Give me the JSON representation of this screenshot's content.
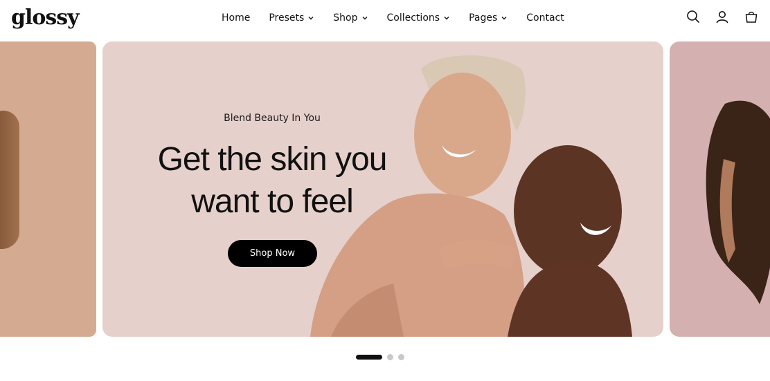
{
  "brand": {
    "logo_text": "glossy"
  },
  "nav": {
    "items": [
      {
        "label": "Home",
        "has_dropdown": false
      },
      {
        "label": "Presets",
        "has_dropdown": true
      },
      {
        "label": "Shop",
        "has_dropdown": true
      },
      {
        "label": "Collections",
        "has_dropdown": true
      },
      {
        "label": "Pages",
        "has_dropdown": true
      },
      {
        "label": "Contact",
        "has_dropdown": false
      }
    ]
  },
  "header_icons": [
    "search-icon",
    "account-icon",
    "cart-icon"
  ],
  "hero": {
    "subtitle": "Blend Beauty In You",
    "headline_line1": "Get the skin you",
    "headline_line2": "want to feel",
    "cta_label": "Shop Now"
  },
  "slider": {
    "total_slides": 3,
    "active_index": 0
  },
  "colors": {
    "hero_bg": "#e6d0cb",
    "left_slide_bg": "#d4ab91",
    "right_slide_bg": "#d4b1b0",
    "cta_bg": "#000000",
    "text": "#111111"
  }
}
